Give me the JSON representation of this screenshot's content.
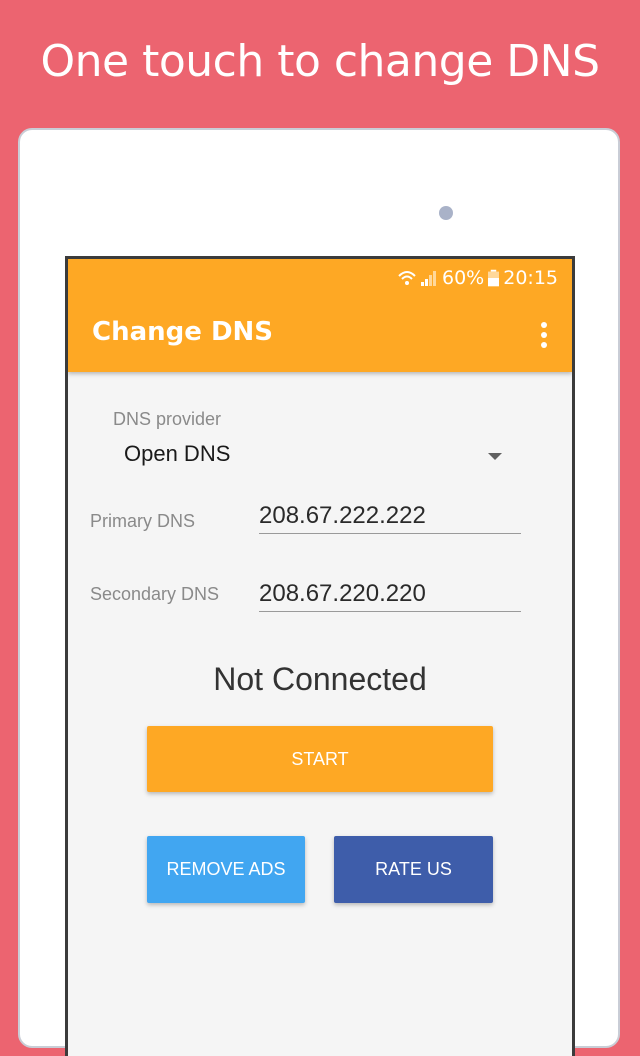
{
  "promo": {
    "headline": "One touch to change DNS"
  },
  "status_bar": {
    "battery": "60%",
    "time": "20:15"
  },
  "app": {
    "title": "Change DNS"
  },
  "form": {
    "provider_label": "DNS provider",
    "provider_value": "Open DNS",
    "primary_label": "Primary DNS",
    "primary_value": "208.67.222.222",
    "secondary_label": "Secondary DNS",
    "secondary_value": "208.67.220.220"
  },
  "connection": {
    "status": "Not Connected"
  },
  "buttons": {
    "start": "START",
    "remove_ads": "REMOVE ADS",
    "rate_us": "RATE US"
  },
  "colors": {
    "background": "#ec6470",
    "accent": "#fea824",
    "remove_ads": "#41a6f1",
    "rate_us": "#3e5daa"
  },
  "icons": [
    "wifi-icon",
    "signal-icon",
    "battery-icon",
    "more-vert-icon",
    "dropdown-arrow-icon"
  ]
}
